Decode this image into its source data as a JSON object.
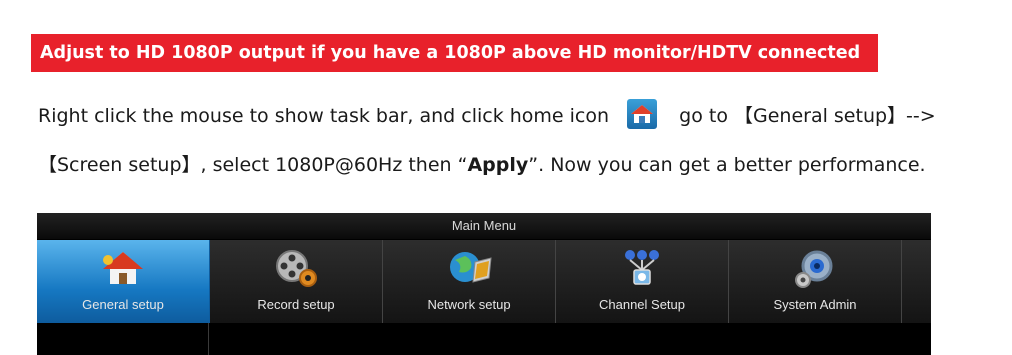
{
  "banner": {
    "text": "Adjust to HD 1080P output if you have a 1080P above HD monitor/HDTV connected"
  },
  "instructions": {
    "line1_before_icon": "Right click the mouse to show task bar, and click home icon",
    "line1_after_icon": "go to 【General setup】-->",
    "line2_prefix": "【Screen setup】, select 1080P@60Hz then “",
    "line2_bold": "Apply",
    "line2_suffix": "”. Now you can get a better performance."
  },
  "dvr_menu": {
    "title": "Main Menu",
    "tabs": [
      {
        "label": "General setup",
        "icon": "home-icon",
        "active": true
      },
      {
        "label": "Record setup",
        "icon": "film-reel-gear-icon",
        "active": false
      },
      {
        "label": "Network setup",
        "icon": "globe-laptop-icon",
        "active": false
      },
      {
        "label": "Channel Setup",
        "icon": "channel-tree-icon",
        "active": false
      },
      {
        "label": "System Admin",
        "icon": "gears-icon",
        "active": false
      }
    ]
  },
  "colors": {
    "banner": "#e8212b",
    "active_tab": "#1678c2",
    "menu_bg": "#000000"
  }
}
